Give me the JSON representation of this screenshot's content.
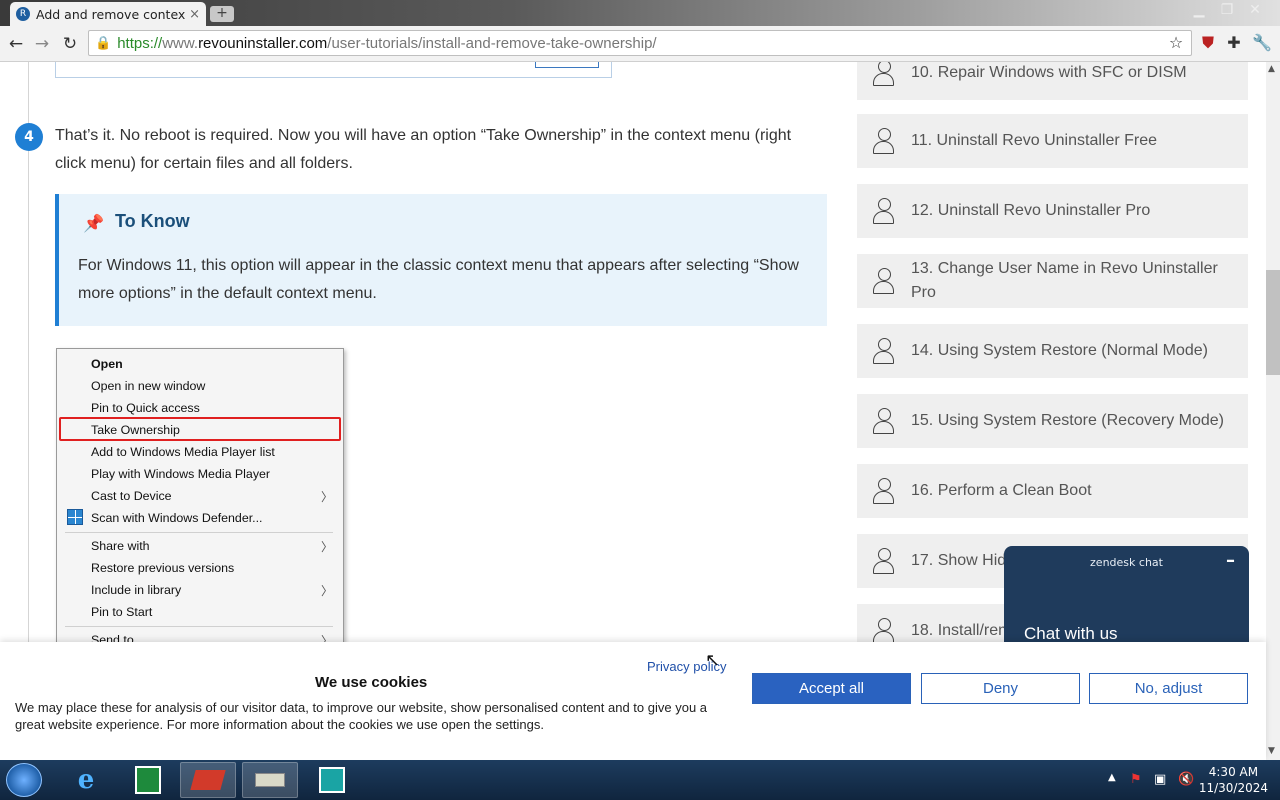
{
  "browser": {
    "tab_title": "Add and remove context m",
    "tab_close": "×",
    "new_tab": "+",
    "url_scheme": "https://",
    "url_sub": "www.",
    "url_domain": "revouninstaller.com",
    "url_path": "/user-tutorials/install-and-remove-take-ownership/"
  },
  "step": {
    "number": "4",
    "text": "That’s it. No reboot is required. Now you will have an option “Take Ownership” in the context menu (right click menu) for certain files and all folders."
  },
  "to_know": {
    "heading": "To Know",
    "body": "For Windows 11, this option will appear in the classic context menu that appears after selecting “Show more options” in the default context menu."
  },
  "context_menu": {
    "items": [
      "Open",
      "Open in new window",
      "Pin to Quick access",
      "Take Ownership",
      "Add to Windows Media Player list",
      "Play with Windows Media Player",
      "Cast to Device",
      "Scan with Windows Defender...",
      "Share with",
      "Restore previous versions",
      "Include in library",
      "Pin to Start",
      "Send to"
    ]
  },
  "sidebar": {
    "items": [
      "10. Repair Windows with SFC or DISM",
      "11. Uninstall Revo Uninstaller Free",
      "12. Uninstall Revo Uninstaller Pro",
      "13. Change User Name in Revo Uninstaller Pro",
      "14. Using System Restore (Normal Mode)",
      "15. Using System Restore (Recovery Mode)",
      "16. Perform a Clean Boot",
      "17. Show Hid",
      "18. Install/rem"
    ]
  },
  "chat": {
    "brand": "zendesk chat",
    "minimize": "–",
    "headline": "Chat with us"
  },
  "cookie": {
    "title": "We use cookies",
    "body": "We may place these for analysis of our visitor data, to improve our website, show personalised content and to give you a great website experience. For more information about the cookies we use open the settings.",
    "privacy": "Privacy policy",
    "accept": "Accept all",
    "deny": "Deny",
    "adjust": "No, adjust"
  },
  "taskbar": {
    "time": "4:30 AM",
    "date": "11/30/2024"
  },
  "icons": {
    "back": "back-arrow-icon",
    "forward": "forward-arrow-icon",
    "reload": "reload-icon",
    "star": "bookmark-star-icon",
    "pin": "pushpin-icon",
    "user": "user-icon"
  },
  "colors": {
    "accent": "#1f7fd4",
    "toknow_bg": "#e8f3fb",
    "chat_bg": "#1f3b5c",
    "accept_bg": "#2a62c0",
    "highlight_border": "#e02020"
  }
}
